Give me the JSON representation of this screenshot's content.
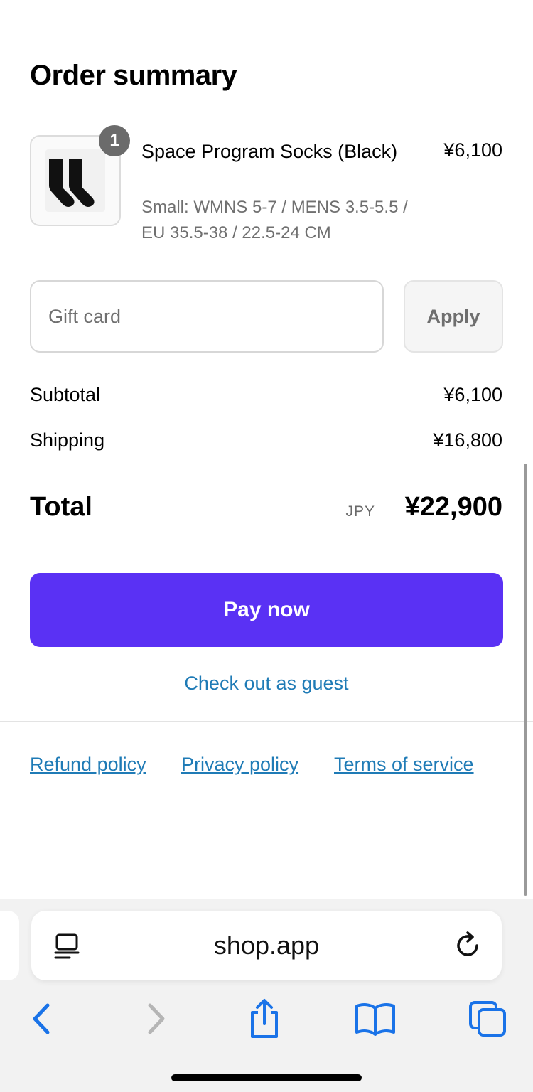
{
  "page": {
    "title": "Order summary"
  },
  "item": {
    "quantity": "1",
    "name": "Space Program Socks (Black)",
    "variant": "Small: WMNS 5-7 / MENS 3.5-5.5 / EU 35.5-38 / 22.5-24 CM",
    "price": "¥6,100",
    "image_icon": "socks-icon"
  },
  "gift_card": {
    "placeholder": "Gift card",
    "apply_label": "Apply"
  },
  "summary": {
    "subtotal_label": "Subtotal",
    "subtotal_value": "¥6,100",
    "shipping_label": "Shipping",
    "shipping_value": "¥16,800",
    "total_label": "Total",
    "total_currency": "JPY",
    "total_value": "¥22,900"
  },
  "actions": {
    "pay_label": "Pay now",
    "guest_label": "Check out as guest"
  },
  "footer": {
    "refund": "Refund policy",
    "privacy": "Privacy policy",
    "terms": "Terms of service"
  },
  "browser": {
    "url": "shop.app"
  },
  "colors": {
    "accent": "#5a31f4",
    "link": "#1f7bb6",
    "ios_blue": "#1a73e8"
  }
}
